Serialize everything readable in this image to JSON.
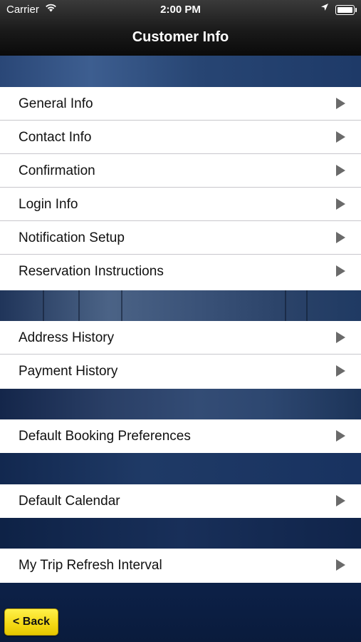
{
  "status_bar": {
    "carrier": "Carrier",
    "time": "2:00 PM"
  },
  "nav": {
    "title": "Customer Info"
  },
  "groups": [
    {
      "items": [
        {
          "label": "General Info"
        },
        {
          "label": "Contact Info"
        },
        {
          "label": "Confirmation"
        },
        {
          "label": "Login Info"
        },
        {
          "label": "Notification Setup"
        },
        {
          "label": "Reservation Instructions"
        }
      ]
    },
    {
      "items": [
        {
          "label": "Address History"
        },
        {
          "label": "Payment History"
        }
      ]
    },
    {
      "items": [
        {
          "label": "Default Booking Preferences"
        }
      ]
    },
    {
      "items": [
        {
          "label": "Default Calendar"
        }
      ]
    },
    {
      "items": [
        {
          "label": "My Trip Refresh Interval"
        }
      ]
    }
  ],
  "back_button": {
    "label": "< Back"
  },
  "colors": {
    "back_button": "#f4d814",
    "background": "#10284d"
  },
  "icons": {
    "row_arrow": "play-arrow-icon",
    "wifi": "wifi-icon",
    "location": "location-arrow-icon",
    "battery": "battery-icon"
  }
}
